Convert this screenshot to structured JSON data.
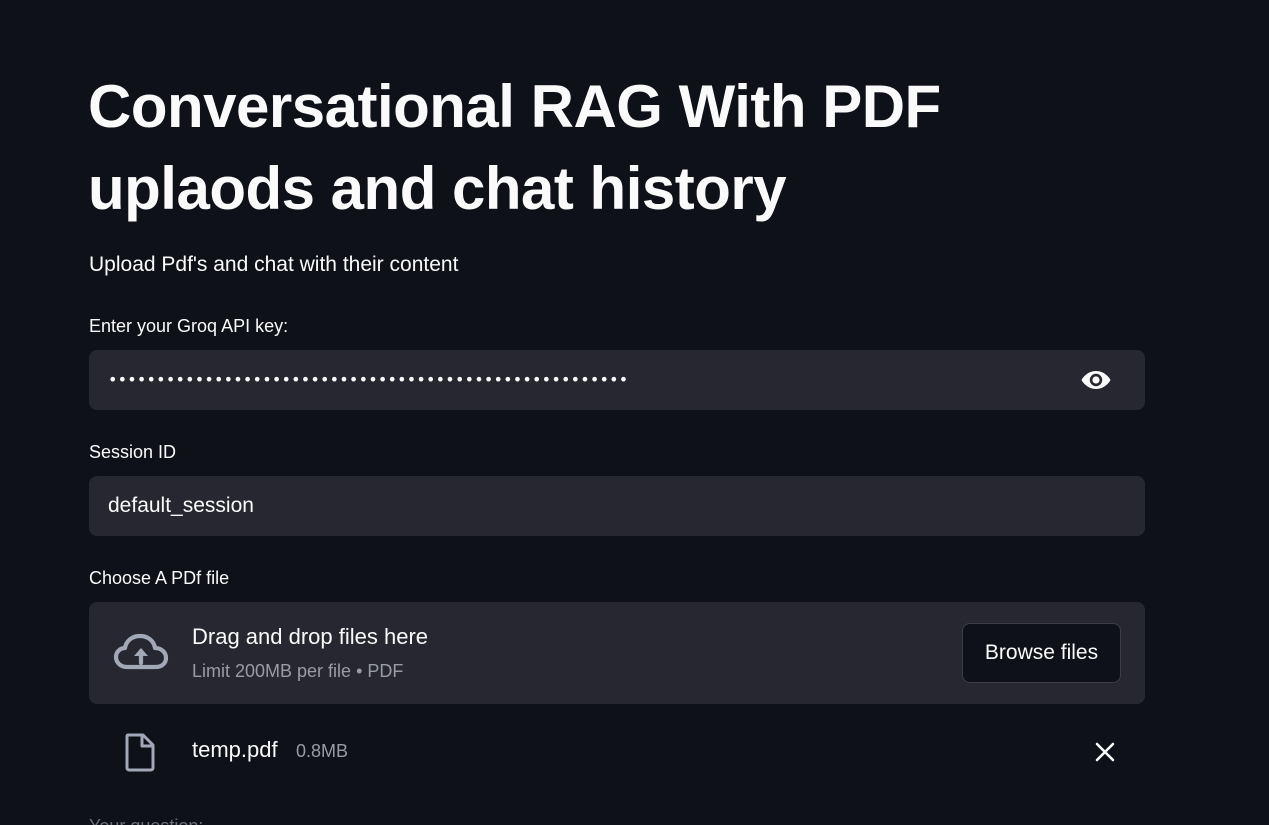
{
  "page": {
    "title": "Conversational RAG With PDF uplaods and chat history",
    "subtitle": "Upload Pdf's and chat with their content"
  },
  "api_key": {
    "label": "Enter your Groq API key:",
    "masked_value": "••••••••••••••••••••••••••••••••••••••••••••••••••••••",
    "toggle_icon": "eye-icon"
  },
  "session": {
    "label": "Session ID",
    "value": "default_session"
  },
  "uploader": {
    "label": "Choose A PDf file",
    "drop_text": "Drag and drop files here",
    "limit_text": "Limit 200MB per file • PDF",
    "browse_label": "Browse files",
    "icon": "cloud-upload-icon"
  },
  "uploaded_file": {
    "name": "temp.pdf",
    "size": "0.8MB",
    "icon": "file-icon",
    "remove_icon": "close-icon"
  },
  "question": {
    "label": "Your question:"
  },
  "colors": {
    "background": "#0e1117",
    "input_bg": "#262730",
    "text": "#fafafa",
    "muted": "#9a9ca5"
  }
}
